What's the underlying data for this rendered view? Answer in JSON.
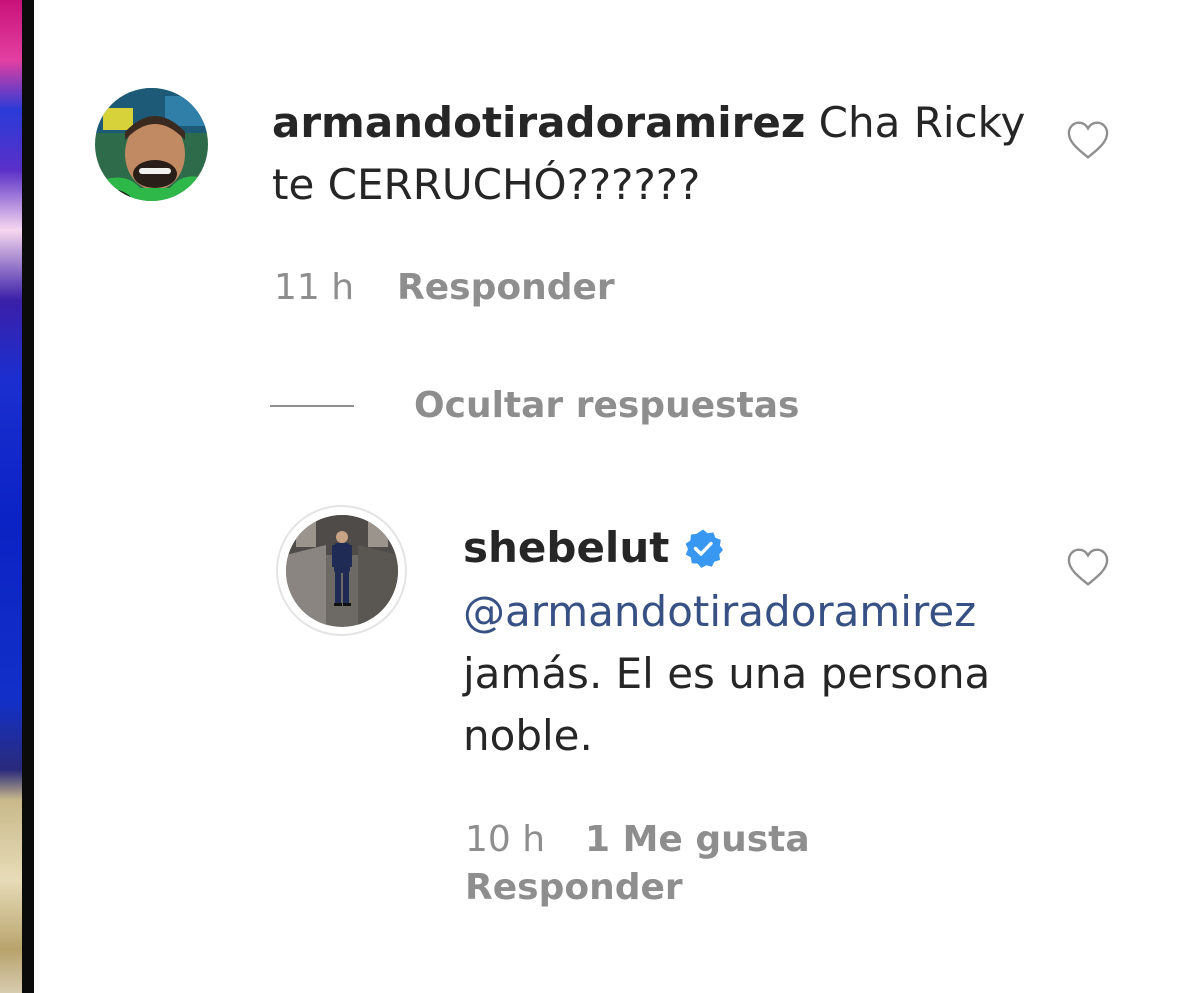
{
  "comments": [
    {
      "username": "armandotiradoramirez",
      "text": "Cha Ricky te CERRUCHÓ??????",
      "time": "11 h",
      "reply_label": "Responder",
      "avatar_icon": "profile-photo"
    }
  ],
  "replies_toggle": {
    "label": "Ocultar respuestas"
  },
  "replies": [
    {
      "username": "shebelut",
      "verified": true,
      "verified_icon": "verified-badge-icon",
      "mention": "@armandotiradoramirez",
      "text": "jamás. El es una persona noble.",
      "time": "10 h",
      "likes_label": "1 Me gusta",
      "reply_label": "Responder",
      "avatar_icon": "profile-photo"
    }
  ],
  "icons": {
    "like": "heart-outline-icon"
  },
  "colors": {
    "text": "#262626",
    "muted": "#8e8e8e",
    "mention": "#385185",
    "verified": "#3897f0"
  }
}
